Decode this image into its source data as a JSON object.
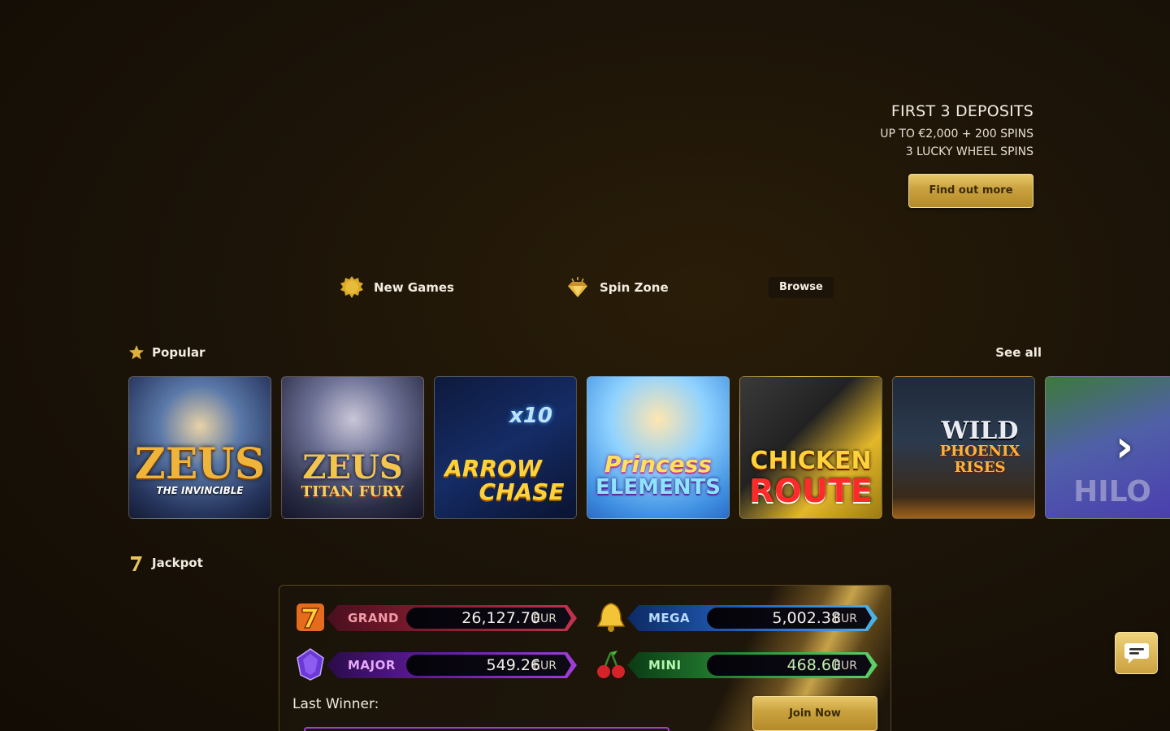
{
  "hero": {
    "title": "FIRST 3 DEPOSITS",
    "line1": "UP TO €2,000 + 200 SPINS",
    "line2": "3 LUCKY WHEEL SPINS",
    "cta_label": "Find out more"
  },
  "categories": {
    "new_games": {
      "label": "New Games",
      "icon": "sun-badge-icon"
    },
    "spin_zone": {
      "label": "Spin Zone",
      "icon": "diamond-icon"
    },
    "browse_label": "Browse"
  },
  "popular": {
    "title": "Popular",
    "icon": "star-icon",
    "see_all_label": "See all",
    "games": [
      {
        "line1": "ZEUS",
        "line2": "THE INVINCIBLE"
      },
      {
        "line1": "ZEUS",
        "line2": "TITAN FURY"
      },
      {
        "line1": "ARROW",
        "line2": "CHASE"
      },
      {
        "line1": "Princess",
        "line2": "ELEMENTS"
      },
      {
        "line1": "CHICKEN",
        "line2": "ROUTE"
      },
      {
        "line1": "WILD",
        "line2": "PHOENIX RISES"
      },
      {
        "line1": "",
        "line2": "HILO"
      }
    ]
  },
  "jackpot": {
    "title": "Jackpot",
    "icon": "seven-icon",
    "tiers": [
      {
        "name": "GRAND",
        "amount": "26,127.70",
        "currency": "EUR",
        "icon": "seven-icon"
      },
      {
        "name": "MEGA",
        "amount": "5,002.38",
        "currency": "EUR",
        "icon": "bell-icon"
      },
      {
        "name": "MAJOR",
        "amount": "549.26",
        "currency": "EUR",
        "icon": "gem-icon"
      },
      {
        "name": "MINI",
        "amount": "468.60",
        "currency": "EUR",
        "icon": "cherry-icon"
      }
    ],
    "last_winner_label": "Last Winner:",
    "join_label": "Join Now"
  },
  "colors": {
    "gold": "#c9a13d",
    "grand": "#c0334d",
    "mega": "#2a6fd6",
    "major": "#8e2fd2",
    "mini": "#2f9c3e"
  }
}
